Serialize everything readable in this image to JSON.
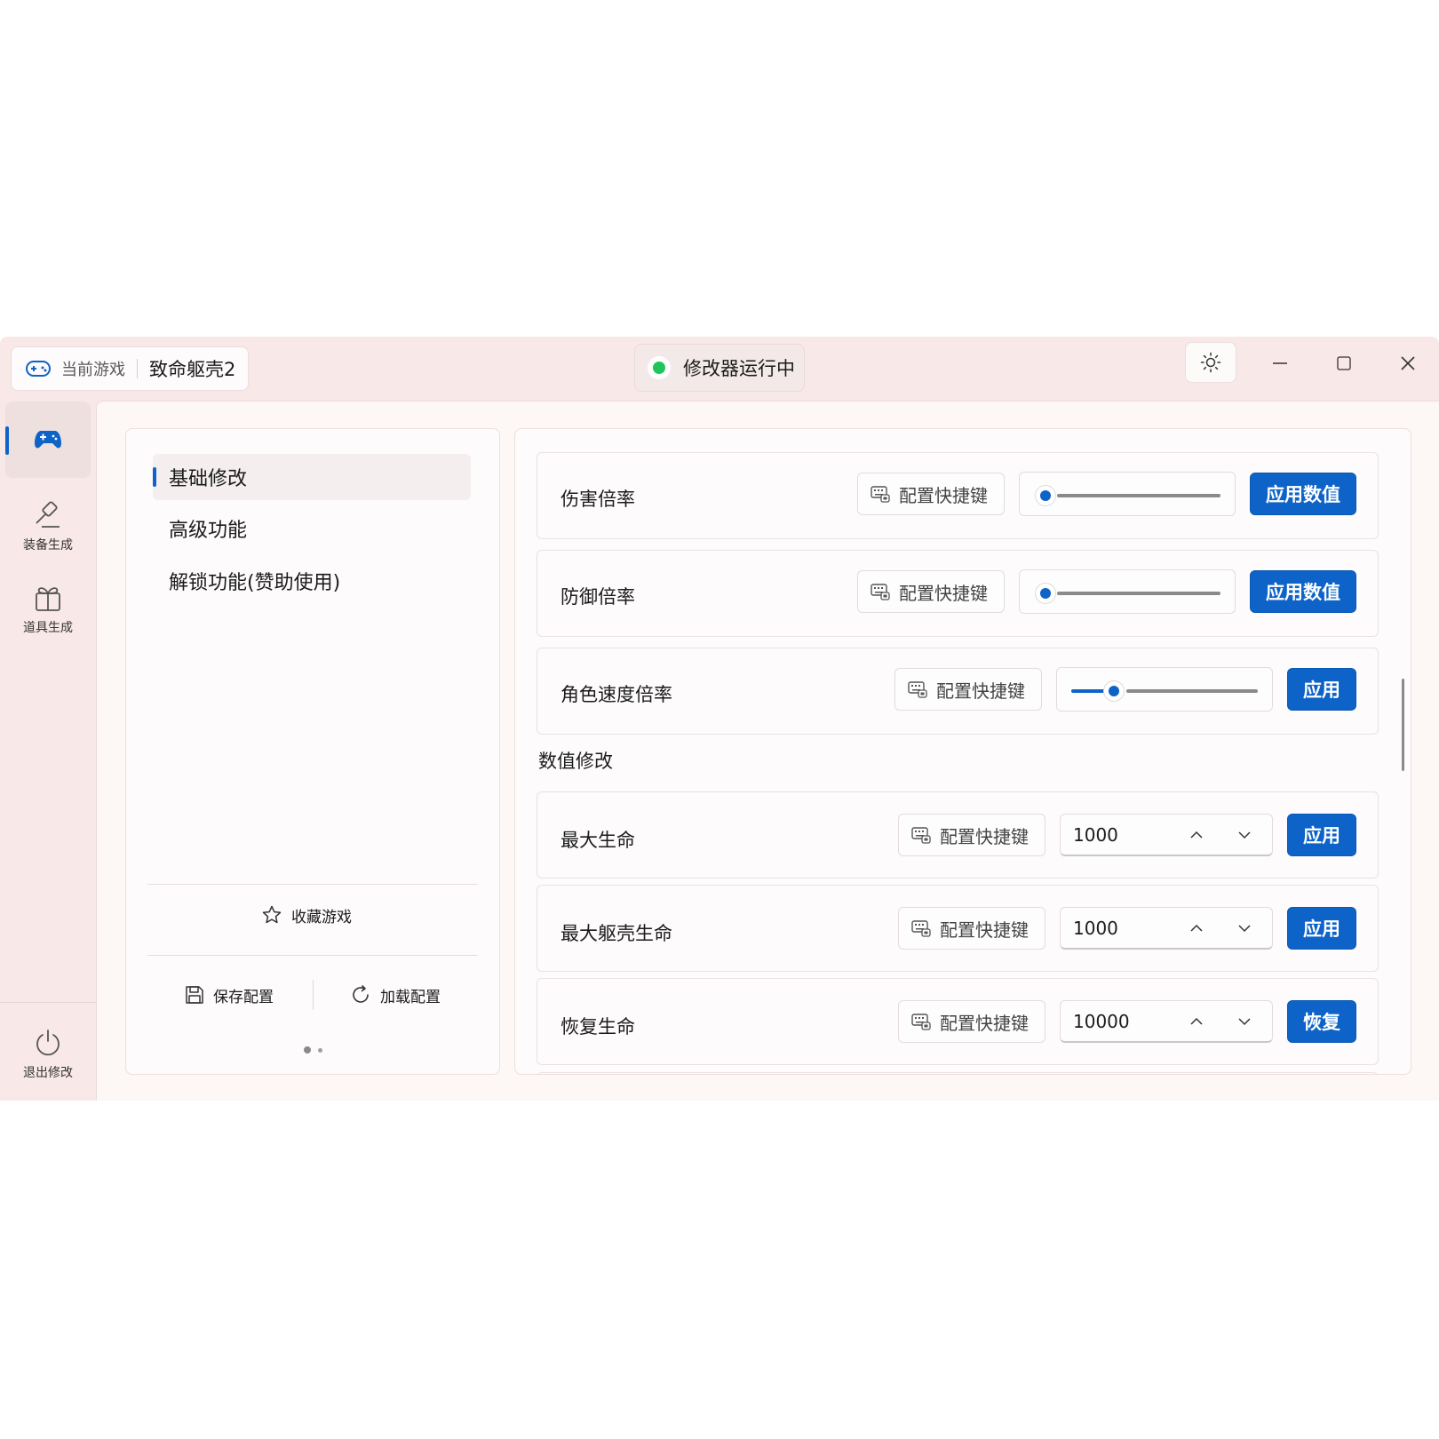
{
  "titlebar": {
    "current_game_label": "当前游戏",
    "game_name": "致命躯壳2",
    "status_text": "修改器运行中",
    "status_color": "#1fc55a"
  },
  "rail": {
    "items": [
      {
        "icon": "gamepad-icon",
        "label": ""
      },
      {
        "icon": "hammer-icon",
        "label": "装备生成"
      },
      {
        "icon": "gift-icon",
        "label": "道具生成"
      }
    ],
    "exit_label": "退出修改"
  },
  "menu": {
    "items": [
      "基础修改",
      "高级功能",
      "解锁功能(赞助使用)"
    ],
    "favorite_label": "收藏游戏",
    "save_label": "保存配置",
    "load_label": "加载配置"
  },
  "rows": {
    "damage": {
      "label": "伤害倍率",
      "hotkey": "配置快捷键",
      "slider_value": 0,
      "button": "应用数值"
    },
    "defense": {
      "label": "防御倍率",
      "hotkey": "配置快捷键",
      "slider_value": 0,
      "button": "应用数值"
    },
    "speed": {
      "label": "角色速度倍率",
      "hotkey": "配置快捷键",
      "slider_value": 0.2,
      "button": "应用"
    }
  },
  "section_title": "数值修改",
  "num_rows": {
    "max_hp": {
      "label": "最大生命",
      "hotkey": "配置快捷键",
      "value": "1000",
      "button": "应用"
    },
    "max_shell_hp": {
      "label": "最大躯壳生命",
      "hotkey": "配置快捷键",
      "value": "1000",
      "button": "应用"
    },
    "restore_hp": {
      "label": "恢复生命",
      "hotkey": "配置快捷键",
      "value": "10000",
      "button": "恢复"
    }
  },
  "colors": {
    "accent": "#0d63c7",
    "window_bg": "#f8e8e7"
  }
}
